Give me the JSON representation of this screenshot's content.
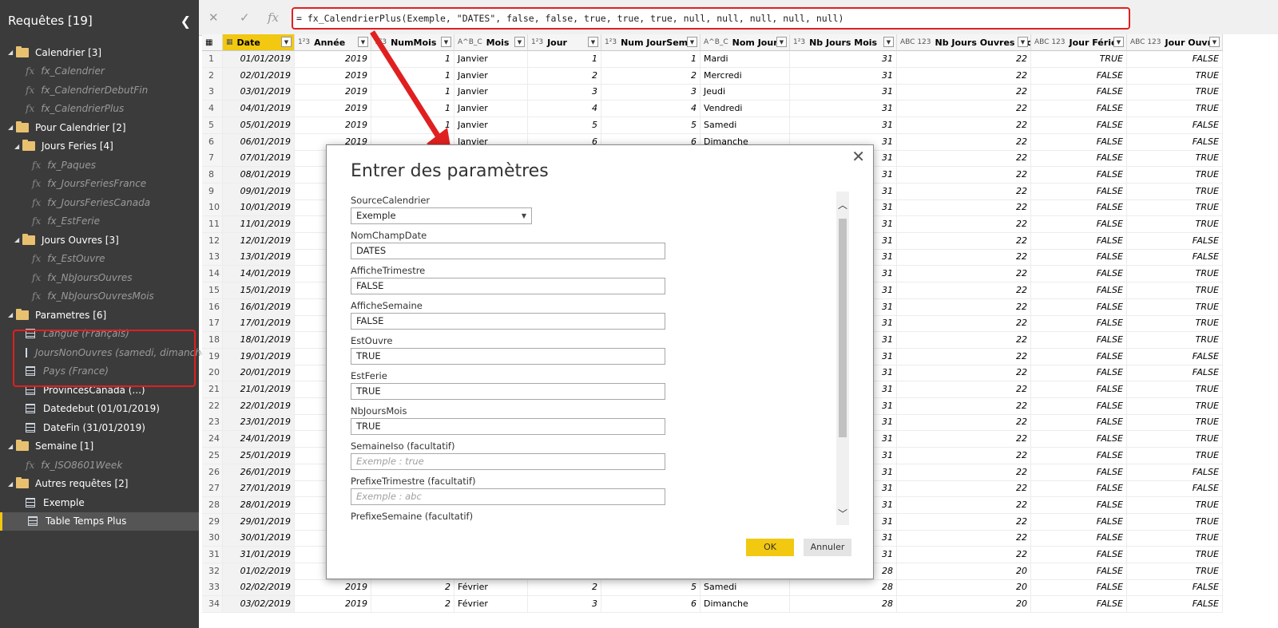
{
  "left_panel": {
    "header": "Requêtes [19]",
    "items": [
      {
        "label": "Calendrier [3]"
      },
      {
        "label": "fx_Calendrier"
      },
      {
        "label": "fx_CalendrierDebutFin"
      },
      {
        "label": "fx_CalendrierPlus"
      },
      {
        "label": "Pour Calendrier [2]"
      },
      {
        "label": "Jours Feries [4]"
      },
      {
        "label": "fx_Paques"
      },
      {
        "label": "fx_JoursFeriesFrance"
      },
      {
        "label": "fx_JoursFeriesCanada"
      },
      {
        "label": "fx_EstFerie"
      },
      {
        "label": "Jours Ouvres [3]"
      },
      {
        "label": "fx_EstOuvre"
      },
      {
        "label": "fx_NbJoursOuvres"
      },
      {
        "label": "fx_NbJoursOuvresMois"
      },
      {
        "label": "Parametres [6]"
      },
      {
        "label": "Langue (Français)"
      },
      {
        "label": "JoursNonOuvres (samedi, dimanche)"
      },
      {
        "label": "Pays (France)"
      },
      {
        "label": "ProvincesCanada (...)"
      },
      {
        "label": "Datedebut (01/01/2019)"
      },
      {
        "label": "DateFin (31/01/2019)"
      },
      {
        "label": "Semaine [1]"
      },
      {
        "label": "fx_ISO8601Week"
      },
      {
        "label": "Autres requêtes [2]"
      },
      {
        "label": "Exemple"
      },
      {
        "label": "Table Temps Plus"
      }
    ]
  },
  "formula_bar": {
    "cancel_icon": "✕",
    "confirm_icon": "✓",
    "fx_icon": "fx",
    "formula": "= fx_CalendrierPlus(Exemple, \"DATES\", false, false, true, true, true, null, null, null, null, null)"
  },
  "grid": {
    "columns": [
      {
        "type": "",
        "label": "Date"
      },
      {
        "type": "1²3",
        "label": "Année"
      },
      {
        "type": "1²3",
        "label": "NumMois"
      },
      {
        "type": "A^B_C",
        "label": "Mois"
      },
      {
        "type": "1²3",
        "label": "Jour"
      },
      {
        "type": "1²3",
        "label": "Num JourSem"
      },
      {
        "type": "A^B_C",
        "label": "Nom Jour"
      },
      {
        "type": "1²3",
        "label": "Nb Jours Mois"
      },
      {
        "type": "ABC 123",
        "label": "Nb Jours Ouvres Mois"
      },
      {
        "type": "ABC 123",
        "label": "Jour Férié"
      },
      {
        "type": "ABC 123",
        "label": "Jour Ouvre"
      }
    ],
    "rows": [
      [
        "1",
        "01/01/2019",
        "2019",
        "1",
        "Janvier",
        "1",
        "1",
        "Mardi",
        "31",
        "22",
        "TRUE",
        "FALSE"
      ],
      [
        "2",
        "02/01/2019",
        "2019",
        "1",
        "Janvier",
        "2",
        "2",
        "Mercredi",
        "31",
        "22",
        "FALSE",
        "TRUE"
      ],
      [
        "3",
        "03/01/2019",
        "2019",
        "1",
        "Janvier",
        "3",
        "3",
        "Jeudi",
        "31",
        "22",
        "FALSE",
        "TRUE"
      ],
      [
        "4",
        "04/01/2019",
        "2019",
        "1",
        "Janvier",
        "4",
        "4",
        "Vendredi",
        "31",
        "22",
        "FALSE",
        "TRUE"
      ],
      [
        "5",
        "05/01/2019",
        "2019",
        "1",
        "Janvier",
        "5",
        "5",
        "Samedi",
        "31",
        "22",
        "FALSE",
        "FALSE"
      ],
      [
        "6",
        "06/01/2019",
        "2019",
        "1",
        "Janvier",
        "6",
        "6",
        "Dimanche",
        "31",
        "22",
        "FALSE",
        "FALSE"
      ],
      [
        "7",
        "07/01/2019",
        "",
        "",
        "",
        "",
        "",
        "",
        "31",
        "22",
        "FALSE",
        "TRUE"
      ],
      [
        "8",
        "08/01/2019",
        "",
        "",
        "",
        "",
        "",
        "",
        "31",
        "22",
        "FALSE",
        "TRUE"
      ],
      [
        "9",
        "09/01/2019",
        "",
        "",
        "",
        "",
        "",
        "",
        "31",
        "22",
        "FALSE",
        "TRUE"
      ],
      [
        "10",
        "10/01/2019",
        "",
        "",
        "",
        "",
        "",
        "",
        "31",
        "22",
        "FALSE",
        "TRUE"
      ],
      [
        "11",
        "11/01/2019",
        "",
        "",
        "",
        "",
        "",
        "",
        "31",
        "22",
        "FALSE",
        "TRUE"
      ],
      [
        "12",
        "12/01/2019",
        "",
        "",
        "",
        "",
        "",
        "",
        "31",
        "22",
        "FALSE",
        "FALSE"
      ],
      [
        "13",
        "13/01/2019",
        "",
        "",
        "",
        "",
        "",
        "",
        "31",
        "22",
        "FALSE",
        "FALSE"
      ],
      [
        "14",
        "14/01/2019",
        "",
        "",
        "",
        "",
        "",
        "",
        "31",
        "22",
        "FALSE",
        "TRUE"
      ],
      [
        "15",
        "15/01/2019",
        "",
        "",
        "",
        "",
        "",
        "",
        "31",
        "22",
        "FALSE",
        "TRUE"
      ],
      [
        "16",
        "16/01/2019",
        "",
        "",
        "",
        "",
        "",
        "",
        "31",
        "22",
        "FALSE",
        "TRUE"
      ],
      [
        "17",
        "17/01/2019",
        "",
        "",
        "",
        "",
        "",
        "",
        "31",
        "22",
        "FALSE",
        "TRUE"
      ],
      [
        "18",
        "18/01/2019",
        "",
        "",
        "",
        "",
        "",
        "",
        "31",
        "22",
        "FALSE",
        "TRUE"
      ],
      [
        "19",
        "19/01/2019",
        "",
        "",
        "",
        "",
        "",
        "",
        "31",
        "22",
        "FALSE",
        "FALSE"
      ],
      [
        "20",
        "20/01/2019",
        "",
        "",
        "",
        "",
        "",
        "",
        "31",
        "22",
        "FALSE",
        "FALSE"
      ],
      [
        "21",
        "21/01/2019",
        "",
        "",
        "",
        "",
        "",
        "",
        "31",
        "22",
        "FALSE",
        "TRUE"
      ],
      [
        "22",
        "22/01/2019",
        "",
        "",
        "",
        "",
        "",
        "",
        "31",
        "22",
        "FALSE",
        "TRUE"
      ],
      [
        "23",
        "23/01/2019",
        "",
        "",
        "",
        "",
        "",
        "",
        "31",
        "22",
        "FALSE",
        "TRUE"
      ],
      [
        "24",
        "24/01/2019",
        "",
        "",
        "",
        "",
        "",
        "",
        "31",
        "22",
        "FALSE",
        "TRUE"
      ],
      [
        "25",
        "25/01/2019",
        "",
        "",
        "",
        "",
        "",
        "",
        "31",
        "22",
        "FALSE",
        "TRUE"
      ],
      [
        "26",
        "26/01/2019",
        "",
        "",
        "",
        "",
        "",
        "",
        "31",
        "22",
        "FALSE",
        "FALSE"
      ],
      [
        "27",
        "27/01/2019",
        "",
        "",
        "",
        "",
        "",
        "",
        "31",
        "22",
        "FALSE",
        "FALSE"
      ],
      [
        "28",
        "28/01/2019",
        "",
        "",
        "",
        "",
        "",
        "",
        "31",
        "22",
        "FALSE",
        "TRUE"
      ],
      [
        "29",
        "29/01/2019",
        "",
        "",
        "",
        "",
        "",
        "",
        "31",
        "22",
        "FALSE",
        "TRUE"
      ],
      [
        "30",
        "30/01/2019",
        "",
        "",
        "",
        "",
        "",
        "",
        "31",
        "22",
        "FALSE",
        "TRUE"
      ],
      [
        "31",
        "31/01/2019",
        "",
        "",
        "",
        "",
        "",
        "",
        "31",
        "22",
        "FALSE",
        "TRUE"
      ],
      [
        "32",
        "01/02/2019",
        "",
        "",
        "",
        "",
        "",
        "",
        "28",
        "20",
        "FALSE",
        "TRUE"
      ],
      [
        "33",
        "02/02/2019",
        "2019",
        "2",
        "Février",
        "2",
        "5",
        "Samedi",
        "28",
        "20",
        "FALSE",
        "FALSE"
      ],
      [
        "34",
        "03/02/2019",
        "2019",
        "2",
        "Février",
        "3",
        "6",
        "Dimanche",
        "28",
        "20",
        "FALSE",
        "FALSE"
      ]
    ]
  },
  "dialog": {
    "title": "Entrer des paramètres",
    "close_icon": "✕",
    "params": [
      {
        "label": "SourceCalendrier",
        "value": "Exemple",
        "kind": "select"
      },
      {
        "label": "NomChampDate",
        "value": "DATES",
        "kind": "text"
      },
      {
        "label": "AfficheTrimestre",
        "value": "FALSE",
        "kind": "text"
      },
      {
        "label": "AfficheSemaine",
        "value": "FALSE",
        "kind": "text"
      },
      {
        "label": "EstOuvre",
        "value": "TRUE",
        "kind": "text"
      },
      {
        "label": "EstFerie",
        "value": "TRUE",
        "kind": "text"
      },
      {
        "label": "NbJoursMois",
        "value": "TRUE",
        "kind": "text"
      },
      {
        "label": "SemaineIso (facultatif)",
        "placeholder": "Exemple : true",
        "kind": "text"
      },
      {
        "label": "PrefixeTrimestre (facultatif)",
        "placeholder": "Exemple : abc",
        "kind": "text"
      },
      {
        "label": "PrefixeSemaine (facultatif)",
        "kind": "label"
      }
    ],
    "ok_label": "OK",
    "cancel_label": "Annuler"
  },
  "colors": {
    "accent": "#f2c811",
    "annotation_red": "#e02020",
    "panel_bg": "#3b3b3b"
  }
}
